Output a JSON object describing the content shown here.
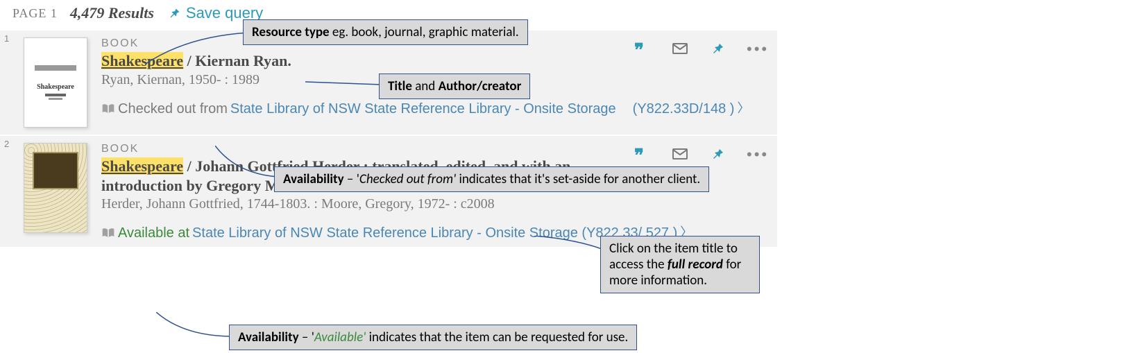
{
  "header": {
    "page_label": "PAGE 1",
    "results_count": "4,479 Results",
    "save_query": "Save query"
  },
  "results": [
    {
      "num": "1",
      "type": "BOOK",
      "title_highlighted": "Shakespeare",
      "title_rest": " / Kiernan Ryan.",
      "byline": "Ryan, Kiernan, 1950- : 1989",
      "avail_status": "Checked out from",
      "avail_status_class": "",
      "location_link": "State Library of NSW  State Reference Library - Onsite Storage",
      "callnum": "(Y822.33D/148 )",
      "thumb_label": "Shakespeare"
    },
    {
      "num": "2",
      "type": "BOOK",
      "title_highlighted": "Shakespeare",
      "title_rest": " / Johann Gottfried Herder ; translated, edited, and with an introduction by Gregory Moore.",
      "byline": "Herder, Johann Gottfried, 1744-1803. : Moore, Gregory, 1972- : c2008",
      "avail_status": "Available at",
      "avail_status_class": "green",
      "location_link": "State Library of NSW  State Reference Library - Onsite Storage (Y822.33/ 527 )",
      "callnum": ""
    }
  ],
  "callouts": {
    "c1": {
      "bold": "Resource type",
      "rest": " eg. book, journal, graphic material."
    },
    "c2": {
      "b1": "Title",
      "mid": " and ",
      "b2": "Author/creator"
    },
    "c3": {
      "bold": "Availability",
      "dash": " – '",
      "ital": "Checked out from'",
      "rest": " indicates that it's set-aside for another client."
    },
    "c4": {
      "line1": "Click on the item title to",
      "line2a": "access the ",
      "line2b": "full record",
      "line2c": " for",
      "line3": "more information."
    },
    "c5": {
      "bold": "Availability",
      "dash": " – '",
      "ital": "Available'",
      "rest": " indicates that the item can be requested for use."
    }
  }
}
